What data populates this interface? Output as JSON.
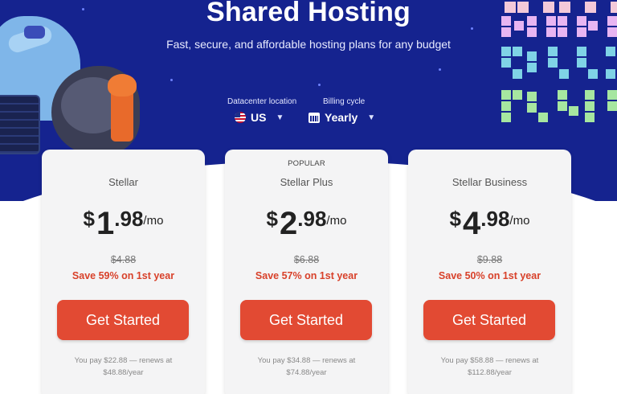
{
  "hero": {
    "title": "Shared Hosting",
    "subtitle": "Fast, secure, and affordable hosting plans for any budget"
  },
  "datacenter": {
    "label": "Datacenter location",
    "value": "US"
  },
  "billing": {
    "label": "Billing cycle",
    "value": "Yearly"
  },
  "plans": [
    {
      "badge": "",
      "name": "Stellar",
      "currency": "$",
      "price_int": "1",
      "price_dec": ".98",
      "period": "/mo",
      "old_price": "$4.88",
      "save": "Save 59% on 1st year",
      "cta": "Get Started",
      "renew": "You pay $22.88 — renews at $48.88/year"
    },
    {
      "badge": "POPULAR",
      "name": "Stellar Plus",
      "currency": "$",
      "price_int": "2",
      "price_dec": ".98",
      "period": "/mo",
      "old_price": "$6.88",
      "save": "Save 57% on 1st year",
      "cta": "Get Started",
      "renew": "You pay $34.88 — renews at $74.88/year"
    },
    {
      "badge": "",
      "name": "Stellar Business",
      "currency": "$",
      "price_int": "4",
      "price_dec": ".98",
      "period": "/mo",
      "old_price": "$9.88",
      "save": "Save 50% on 1st year",
      "cta": "Get Started",
      "renew": "You pay $58.88 — renews at $112.88/year"
    }
  ],
  "colors": {
    "hero_bg": "#15238f",
    "cta": "#e24a33",
    "save_text": "#d8412a"
  }
}
